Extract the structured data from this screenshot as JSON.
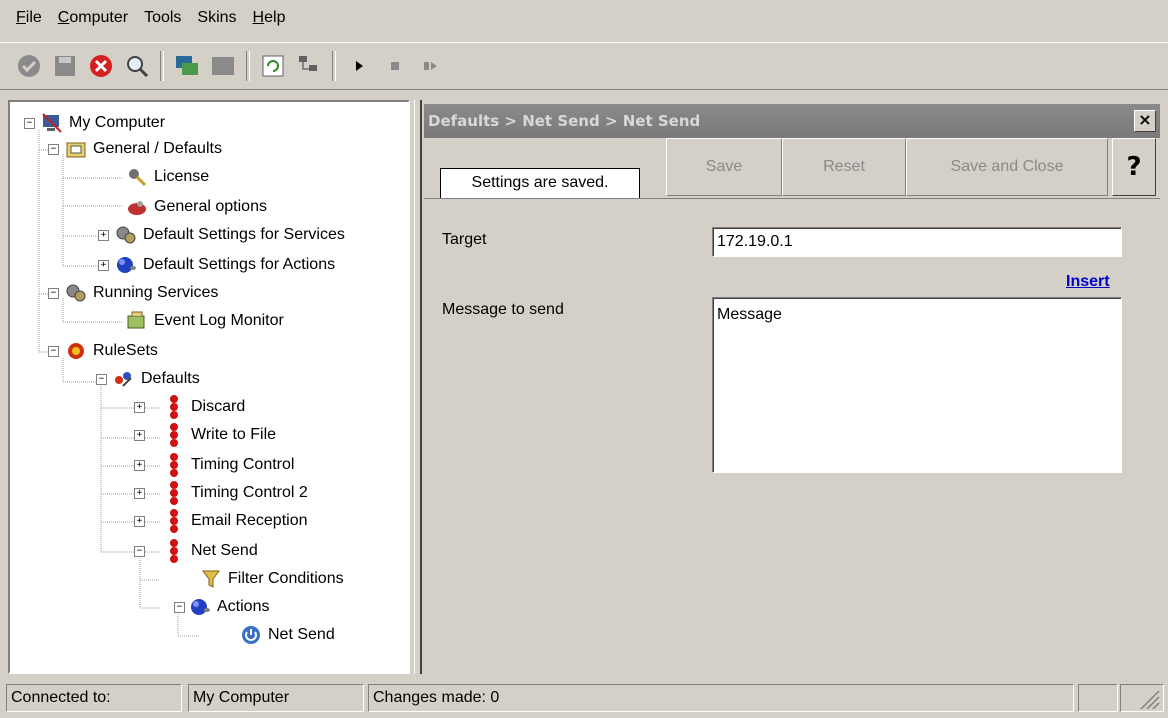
{
  "menu": [
    {
      "label": "File",
      "underline": "F",
      "rest": "ile"
    },
    {
      "label": "Computer",
      "underline": "C",
      "rest": "omputer"
    },
    {
      "label": "Tools",
      "underline": "",
      "rest": "Tools"
    },
    {
      "label": "Skins",
      "underline": "",
      "rest": "Skins"
    },
    {
      "label": "Help",
      "underline": "H",
      "rest": "elp"
    }
  ],
  "toolbar": {
    "icons": [
      "check-circle-icon",
      "save-disk-icon",
      "stop-red-icon",
      "search-magnifier-icon",
      "computer-network-icon",
      "monitor-icon",
      "refresh-icon",
      "tree-config-icon",
      "play-icon",
      "stop-icon",
      "step-icon"
    ]
  },
  "tree": {
    "nodes": [
      {
        "label": "My Computer",
        "icon": "my-computer-icon",
        "pm": "−"
      },
      {
        "label": "General / Defaults",
        "icon": "folder-icon",
        "pm": "−"
      },
      {
        "label": "License",
        "icon": "license-keys-icon",
        "pm": ""
      },
      {
        "label": "General options",
        "icon": "options-icon",
        "pm": ""
      },
      {
        "label": "Default Settings for Services",
        "icon": "gears-icon",
        "pm": "+"
      },
      {
        "label": "Default Settings for Actions",
        "icon": "blue-ball-icon",
        "pm": "+"
      },
      {
        "label": "Running Services",
        "icon": "gears-icon",
        "pm": "−"
      },
      {
        "label": "Event Log Monitor",
        "icon": "event-log-icon",
        "pm": ""
      },
      {
        "label": "RuleSets",
        "icon": "ruleset-icon",
        "pm": "−"
      },
      {
        "label": "Defaults",
        "icon": "defaults-icon",
        "pm": "−"
      },
      {
        "label": "Discard",
        "icon": "rule-red-icon",
        "pm": "+"
      },
      {
        "label": "Write to File",
        "icon": "rule-red-icon",
        "pm": "+"
      },
      {
        "label": "Timing Control",
        "icon": "rule-red-icon",
        "pm": "+"
      },
      {
        "label": "Timing Control 2",
        "icon": "rule-red-icon",
        "pm": "+"
      },
      {
        "label": "Email Reception",
        "icon": "rule-red-icon",
        "pm": "+"
      },
      {
        "label": "Net Send",
        "icon": "rule-red-icon",
        "pm": "−"
      },
      {
        "label": "Filter Conditions",
        "icon": "filter-icon",
        "pm": ""
      },
      {
        "label": "Actions",
        "icon": "blue-ball-icon",
        "pm": "−"
      },
      {
        "label": "Net Send",
        "icon": "power-icon",
        "pm": ""
      }
    ]
  },
  "panel": {
    "breadcrumb": "Defaults > Net Send > Net Send",
    "close": "×",
    "status": "Settings are saved.",
    "buttons": {
      "save": "Save",
      "reset": "Reset",
      "save_close": "Save and Close",
      "help": "?"
    },
    "target_label": "Target",
    "target_value": "172.19.0.1",
    "insert": "Insert",
    "message_label": "Message to send",
    "message_value": "Message"
  },
  "statusbar": {
    "connected_label": "Connected to:",
    "connected_value": "My Computer",
    "changes": "Changes made: 0"
  }
}
